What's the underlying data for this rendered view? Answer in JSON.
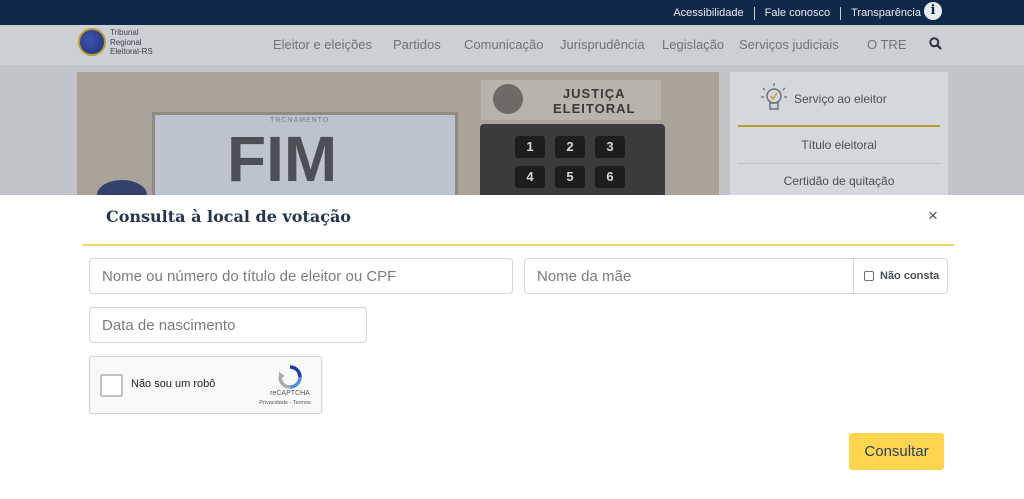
{
  "topbar": {
    "links": [
      "Acessibilidade",
      "Fale conosco",
      "Transparência"
    ],
    "info_icon": "info-icon"
  },
  "header": {
    "logo_lines": [
      "Tribunal",
      "Regional",
      "Eleitoral-RS"
    ],
    "nav": [
      "Eleitor e eleições",
      "Partidos",
      "Comunicação",
      "Jurisprudência",
      "Legislação",
      "Serviços judiciais",
      "O TRE"
    ],
    "search_icon": "search-icon"
  },
  "hero": {
    "screen_top": "TRCNAMENTO",
    "screen_text": "FIM",
    "brand_line1": "JUSTIÇA",
    "brand_line2": "ELEITORAL",
    "keys": [
      "1",
      "2",
      "3",
      "4",
      "5",
      "6"
    ]
  },
  "service": {
    "title": "Serviço ao eleitor",
    "items": [
      "Título eleitoral",
      "Certidão de quitação"
    ]
  },
  "modal": {
    "title": "Consulta à local de votação",
    "close": "×",
    "voter_placeholder": "Nome ou número do título de eleitor ou CPF",
    "mother_placeholder": "Nome da mãe",
    "nao_consta_label": "Não consta",
    "birth_placeholder": "Data de nascimento",
    "captcha_label": "Não sou um robô",
    "captcha_brand": "reCAPTCHA",
    "captcha_links": "Privacidade - Termos",
    "submit_label": "Consultar"
  },
  "colors": {
    "topbar": "#10284a",
    "accent_gold": "#f4d36a",
    "button": "#fdd54f",
    "title": "#243552"
  }
}
